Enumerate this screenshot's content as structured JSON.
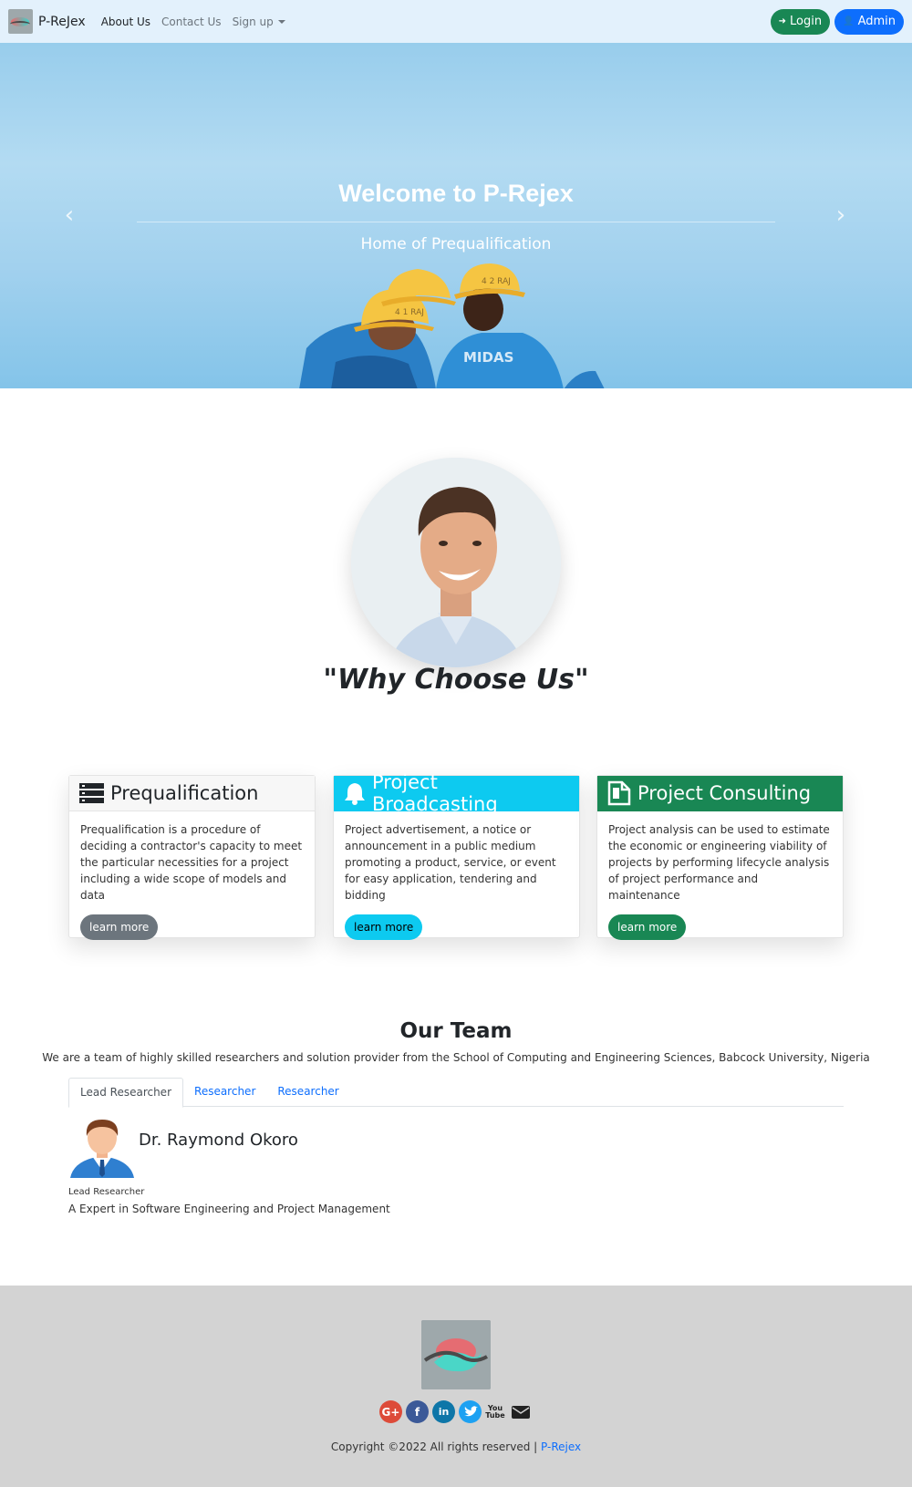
{
  "navbar": {
    "brand": "P-ReJex",
    "links": [
      "About Us",
      "Contact Us",
      "Sign up"
    ],
    "login_label": "Login",
    "admin_label": "Admin"
  },
  "hero": {
    "title": "Welcome to P-Rejex",
    "subtitle": "Home of Prequalification",
    "helmet_labels": [
      "4 1 RAJ",
      "4 2 RAJ"
    ],
    "jacket_text": "MIDAS"
  },
  "about": {
    "heading": "\"Why Choose Us\""
  },
  "cards": [
    {
      "title": "Prequalification",
      "text": "Prequalification is a procedure of deciding a contractor's capacity to meet the particular necessities for a project including a wide scope of models and data",
      "button": "learn more",
      "icon": "server-icon",
      "accent": "#f7f7f7"
    },
    {
      "title": "Project Broadcasting",
      "text": "Project advertisement, a notice or announcement in a public medium promoting a product, service, or event for easy application, tendering and bidding",
      "button": "learn more",
      "icon": "bell-icon",
      "accent": "#0dcaf0"
    },
    {
      "title": "Project Consulting",
      "text": "Project analysis can be used to estimate the economic or engineering viability of projects by performing lifecycle analysis of project performance and maintenance",
      "button": "learn more",
      "icon": "document-icon",
      "accent": "#198754"
    }
  ],
  "team": {
    "title": "Our Team",
    "subtitle": "We are a team of highly skilled researchers and solution provider from the School of Computing and Engineering Sciences, Babcock University, Nigeria",
    "tabs": [
      "Lead Researcher",
      "Researcher",
      "Researcher"
    ],
    "member": {
      "name": "Dr. Raymond Okoro",
      "role": "Lead Researcher",
      "description": "A Expert in Software Engineering and Project Management"
    }
  },
  "footer": {
    "socials": [
      "google-plus-icon",
      "facebook-icon",
      "linkedin-icon",
      "twitter-icon",
      "youtube-icon",
      "envelope-icon"
    ],
    "copyright": "Copyright ©2022 All rights reserved |",
    "copyright_link": "P-Rejex"
  }
}
